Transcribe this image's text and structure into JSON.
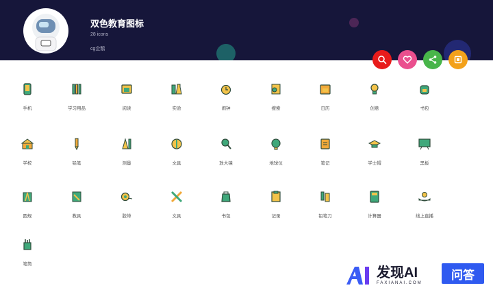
{
  "header": {
    "title": "双色教育图标",
    "count": "28 icons",
    "author": "cg企鹅"
  },
  "actions": [
    {
      "name": "search",
      "color": "#e81b1b"
    },
    {
      "name": "favorite",
      "color": "#ea4f8e"
    },
    {
      "name": "share",
      "color": "#48b54a"
    },
    {
      "name": "download",
      "color": "#f3a11b"
    }
  ],
  "icons": [
    {
      "label": "手机",
      "icon": "phone-icon"
    },
    {
      "label": "学习用品",
      "icon": "books-icon"
    },
    {
      "label": "阅读",
      "icon": "reading-icon"
    },
    {
      "label": "实验",
      "icon": "experiment-icon"
    },
    {
      "label": "闹钟",
      "icon": "alarm-clock-icon"
    },
    {
      "label": "搜索",
      "icon": "search-doc-icon"
    },
    {
      "label": "日历",
      "icon": "calendar-icon"
    },
    {
      "label": "创意",
      "icon": "lightbulb-icon"
    },
    {
      "label": "书包",
      "icon": "backpack-icon"
    },
    {
      "label": "学校",
      "icon": "school-icon"
    },
    {
      "label": "铅笔",
      "icon": "pencil-icon"
    },
    {
      "label": "测量",
      "icon": "ruler-icon"
    },
    {
      "label": "文具",
      "icon": "stationery-icon"
    },
    {
      "label": "放大镜",
      "icon": "magnifier-icon"
    },
    {
      "label": "地球仪",
      "icon": "globe-icon"
    },
    {
      "label": "笔记",
      "icon": "notebook-icon"
    },
    {
      "label": "学士帽",
      "icon": "graduation-cap-icon"
    },
    {
      "label": "黑板",
      "icon": "blackboard-icon"
    },
    {
      "label": "圆规",
      "icon": "compass-icon"
    },
    {
      "label": "教具",
      "icon": "teaching-aid-icon"
    },
    {
      "label": "胶带",
      "icon": "tape-icon"
    },
    {
      "label": "文具",
      "icon": "pen-ruler-icon"
    },
    {
      "label": "书包",
      "icon": "bag-icon"
    },
    {
      "label": "记录",
      "icon": "clipboard-icon"
    },
    {
      "label": "铅笔刀",
      "icon": "sharpener-icon"
    },
    {
      "label": "计算器",
      "icon": "calculator-icon"
    },
    {
      "label": "线上直播",
      "icon": "live-icon"
    },
    {
      "label": "笔筒",
      "icon": "pen-holder-icon"
    }
  ],
  "brand": {
    "name": "发现AI",
    "sub": "FAXIANAI.COM",
    "badge": "问答"
  },
  "colors": {
    "header": "#16163a",
    "icon_dark": "#2e4a3a",
    "icon_yellow": "#f3c34a",
    "icon_orange": "#f1a93a",
    "icon_green": "#3fa87a"
  }
}
